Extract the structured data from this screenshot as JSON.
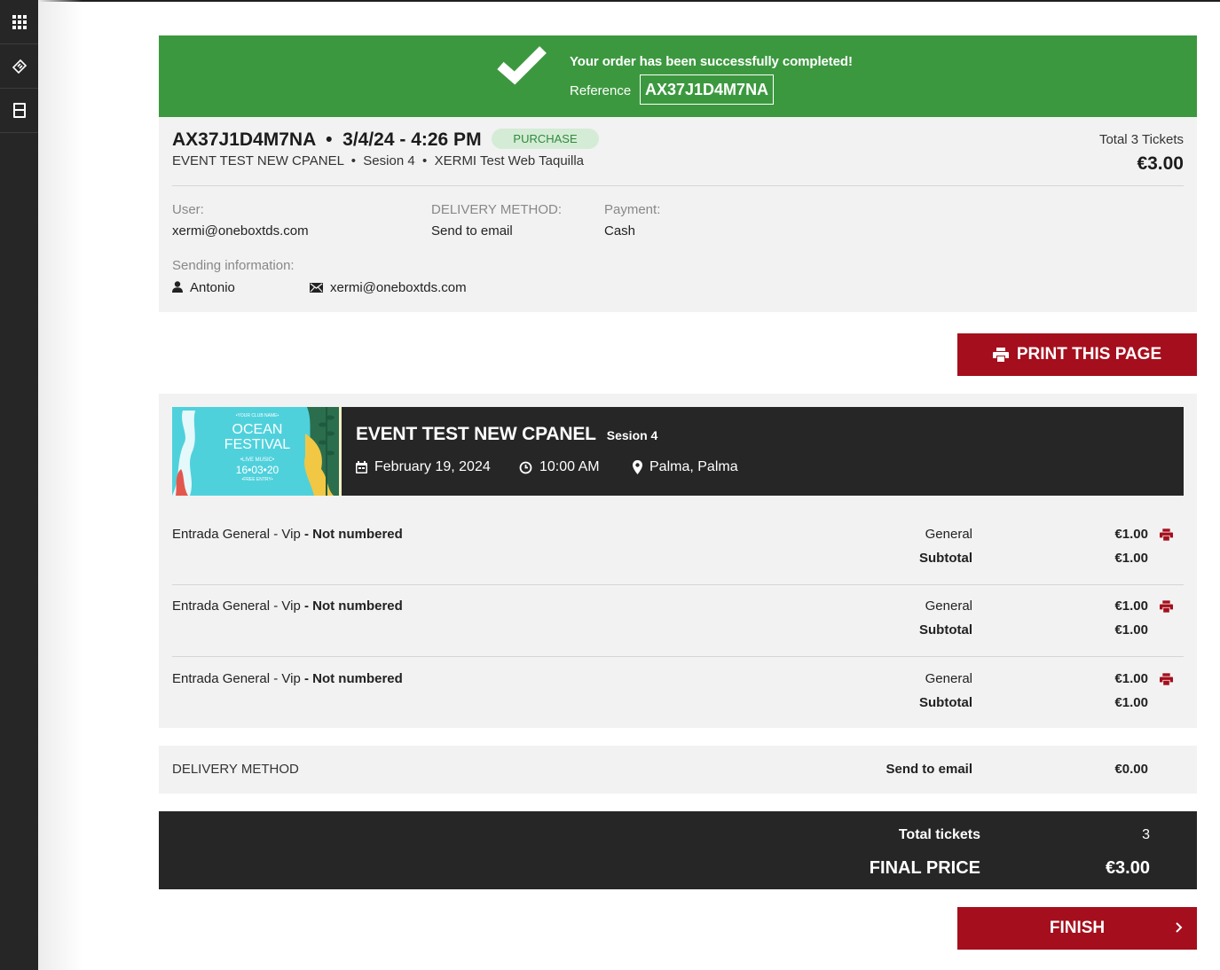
{
  "sidebar": {
    "items": [
      {
        "icon": "grid-icon"
      },
      {
        "icon": "ticket-icon"
      },
      {
        "icon": "calculator-icon"
      }
    ]
  },
  "banner": {
    "message": "Your order has been successfully completed!",
    "reference_label": "Reference",
    "reference_value": "AX37J1D4M7NA",
    "color": "#3c983f"
  },
  "summary": {
    "order_line": "AX37J1D4M7NA  •  3/4/24 - 4:26 PM",
    "badge": "PURCHASE",
    "sub_line": "EVENT TEST NEW CPANEL  •  Sesion 4  •  XERMI Test Web Taquilla",
    "total_label": "Total 3 Tickets",
    "total_value": "€3.00",
    "user_label": "User:",
    "user_value": "xermi@oneboxtds.com",
    "delivery_label": "DELIVERY METHOD:",
    "delivery_value": "Send to email",
    "payment_label": "Payment:",
    "payment_value": "Cash",
    "sending_label": "Sending information:",
    "sending_name": "Antonio",
    "sending_email": "xermi@oneboxtds.com"
  },
  "print_button": {
    "label": "PRINT THIS PAGE",
    "color": "#a50e1c"
  },
  "event": {
    "poster": {
      "top_text": "•YOUR CLUB NAME•",
      "line1": "OCEAN",
      "line2": "FESTIVAL",
      "live": "•LIVE MUSIC•",
      "date": "16•03•20",
      "entry": "•FREE ENTRY•"
    },
    "title": "EVENT TEST NEW CPANEL",
    "session": "Sesion 4",
    "date": "February 19, 2024",
    "time": "10:00 AM",
    "location": "Palma, Palma"
  },
  "tickets": [
    {
      "name": "Entrada General - Vip",
      "suffix": " - Not numbered",
      "zone": "General",
      "price": "€1.00",
      "subtotal_label": "Subtotal",
      "subtotal": "€1.00"
    },
    {
      "name": "Entrada General - Vip",
      "suffix": " - Not numbered",
      "zone": "General",
      "price": "€1.00",
      "subtotal_label": "Subtotal",
      "subtotal": "€1.00"
    },
    {
      "name": "Entrada General - Vip",
      "suffix": " - Not numbered",
      "zone": "General",
      "price": "€1.00",
      "subtotal_label": "Subtotal",
      "subtotal": "€1.00"
    }
  ],
  "delivery": {
    "label": "DELIVERY METHOD",
    "method": "Send to email",
    "price": "€0.00"
  },
  "totals": {
    "tickets_label": "Total tickets",
    "tickets_value": "3",
    "final_label": "FINAL PRICE",
    "final_value": "€3.00"
  },
  "finish_button": {
    "label": "FINISH"
  }
}
